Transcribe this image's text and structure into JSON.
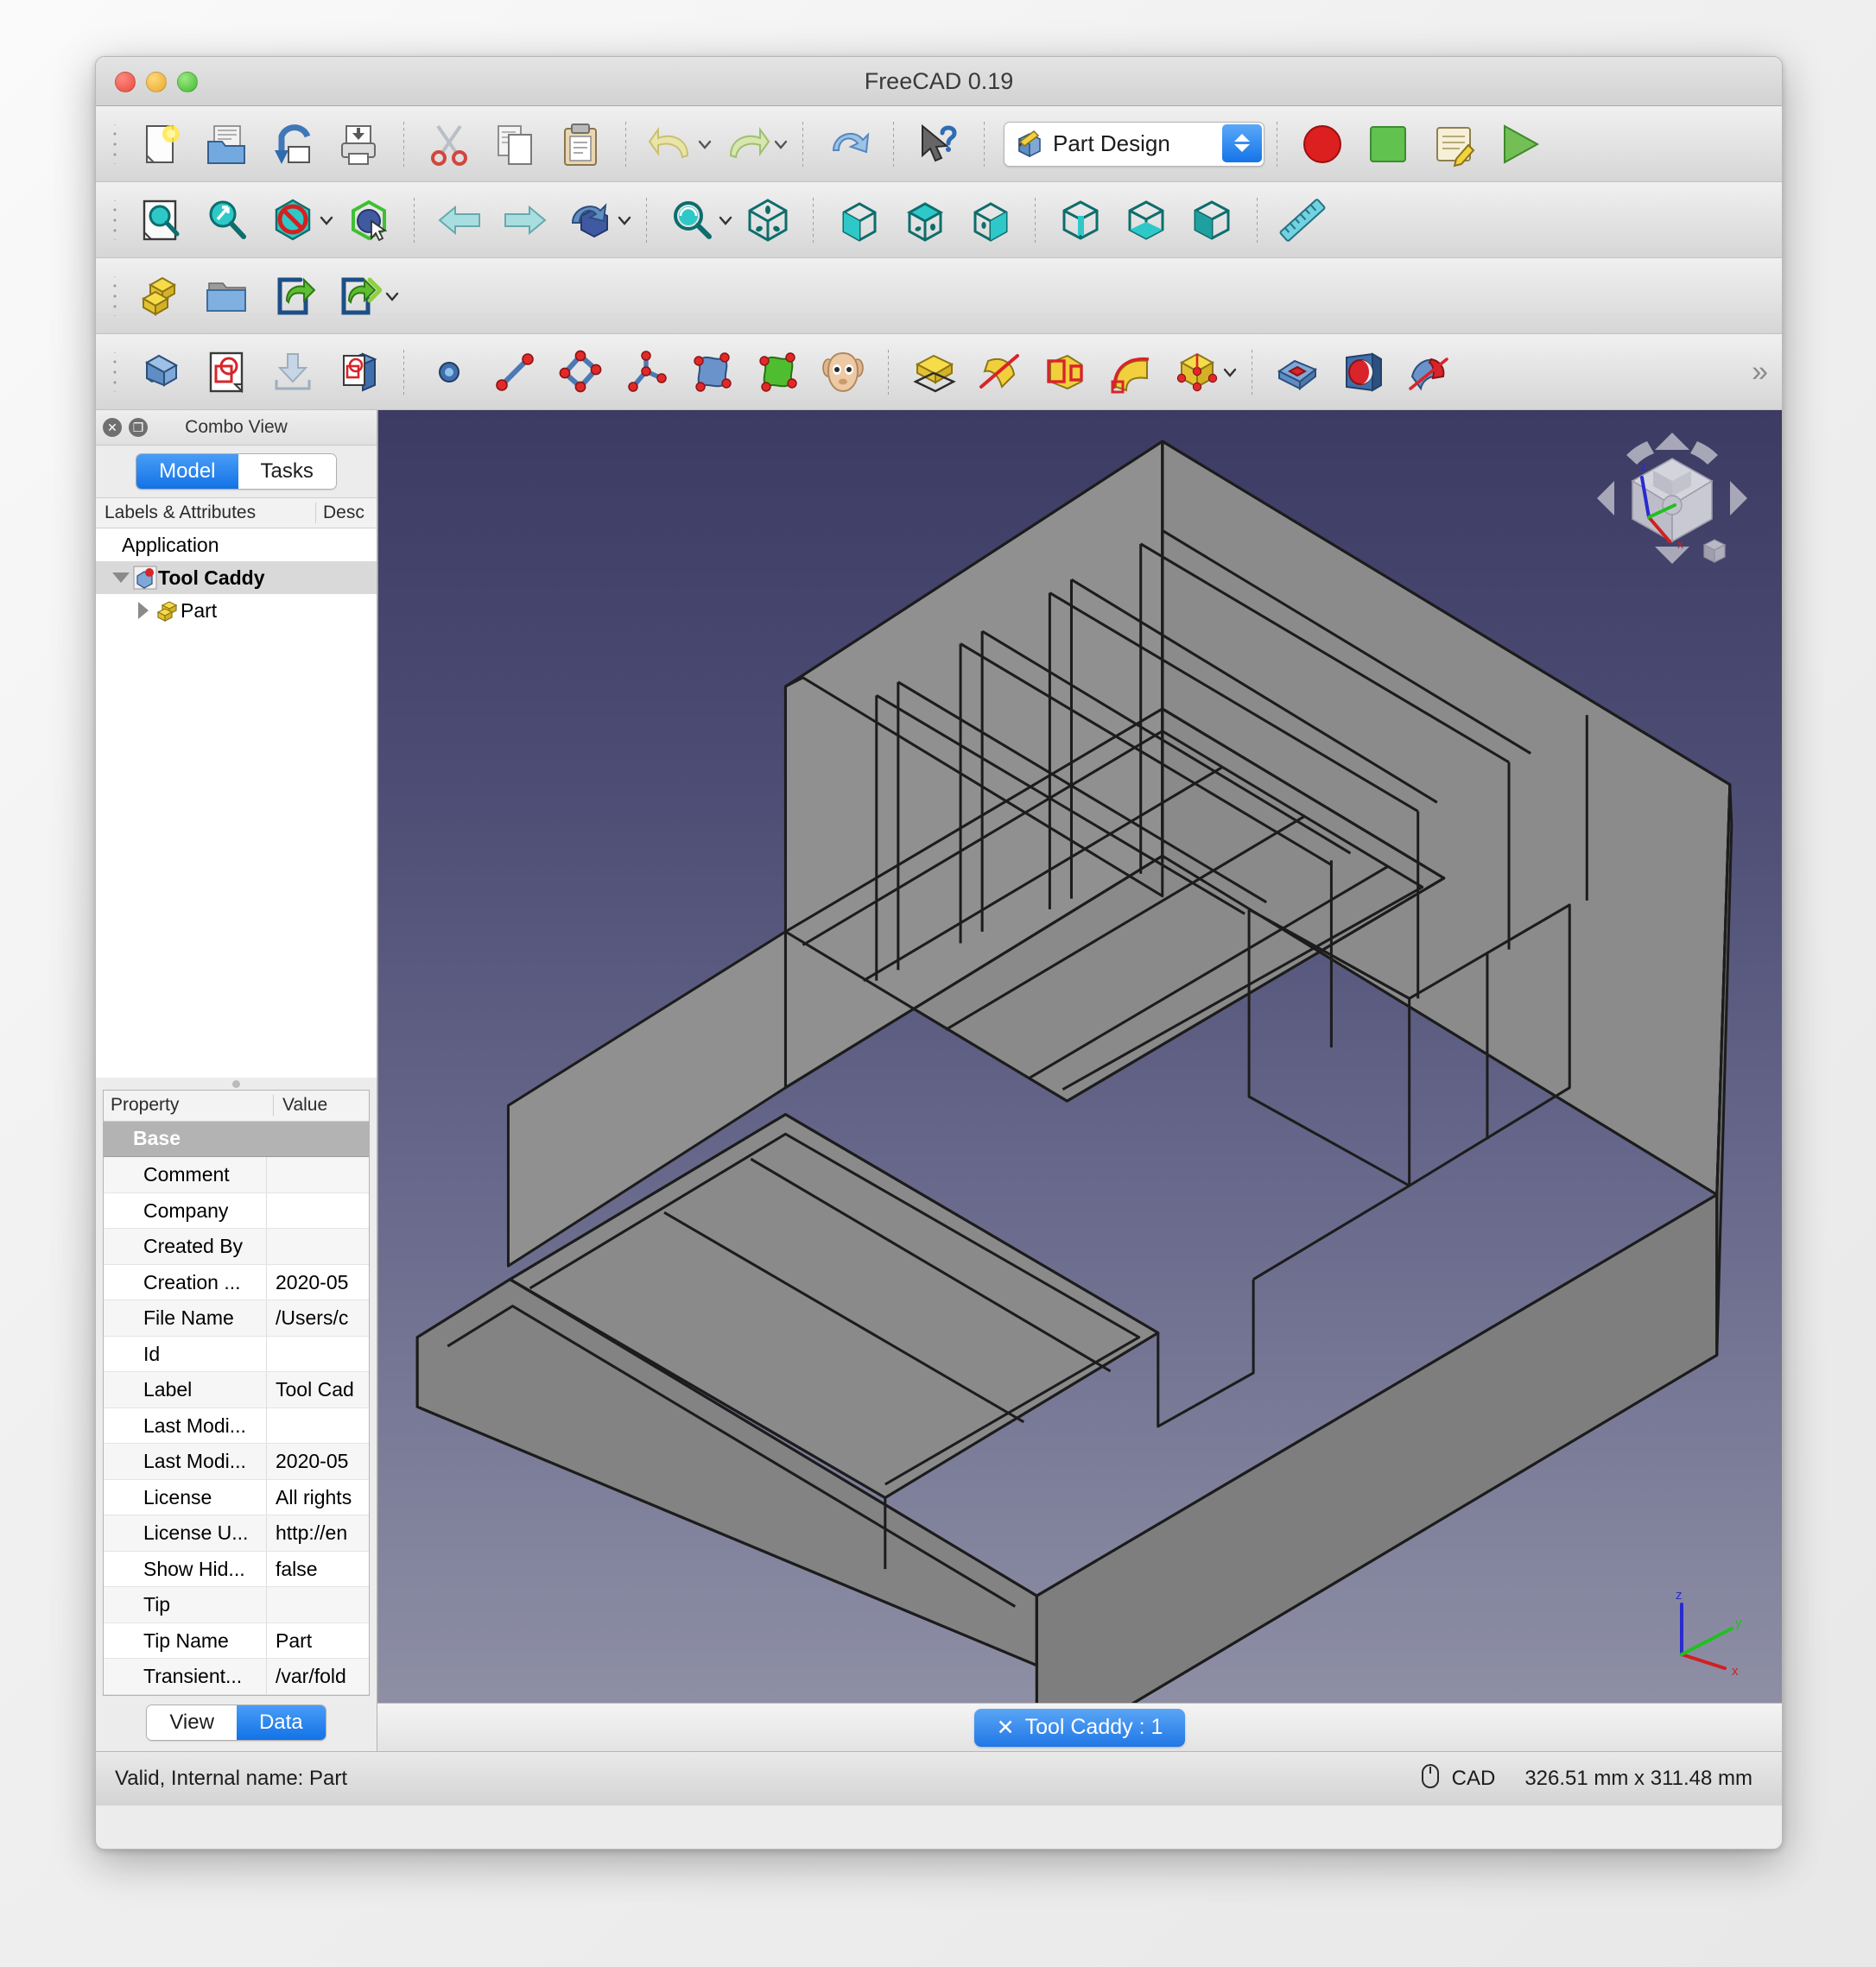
{
  "window": {
    "title": "FreeCAD 0.19",
    "traffic": [
      "close-button",
      "minimize-button",
      "zoom-button"
    ]
  },
  "toolbars": {
    "file": {
      "items": [
        {
          "name": "new-document",
          "icon": "new-file-icon"
        },
        {
          "name": "open-document",
          "icon": "open-folder-icon"
        },
        {
          "name": "save-document",
          "icon": "save-icon"
        },
        {
          "name": "print-document",
          "icon": "print-icon"
        }
      ]
    },
    "edit": {
      "items": [
        {
          "name": "cut",
          "icon": "scissors-icon"
        },
        {
          "name": "copy",
          "icon": "copy-icon"
        },
        {
          "name": "paste",
          "icon": "clipboard-icon"
        }
      ]
    },
    "history": {
      "items": [
        {
          "name": "undo",
          "icon": "undo-arrow-icon"
        },
        {
          "name": "redo",
          "icon": "redo-arrow-icon"
        },
        {
          "name": "refresh",
          "icon": "refresh-icon"
        }
      ]
    },
    "help": {
      "items": [
        {
          "name": "whats-this",
          "icon": "cursor-question-icon"
        }
      ]
    },
    "workbench": {
      "label": "Part Design",
      "icon": "part-design-icon"
    },
    "macro": {
      "items": [
        {
          "name": "macro-record",
          "icon": "record-circle-icon"
        },
        {
          "name": "macro-stop",
          "icon": "stop-square-icon"
        },
        {
          "name": "macros-dialog",
          "icon": "macro-editor-icon"
        },
        {
          "name": "execute-macro",
          "icon": "play-triangle-icon"
        }
      ]
    },
    "view_row": {
      "items": [
        {
          "name": "fit-all",
          "icon": "fit-all-icon"
        },
        {
          "name": "fit-selection",
          "icon": "fit-selection-icon"
        },
        {
          "name": "draw-style",
          "icon": "draw-style-icon"
        },
        {
          "name": "box-selection",
          "icon": "box-selection-icon"
        },
        {
          "name": "view-back",
          "icon": "left-arrow-icon"
        },
        {
          "name": "view-forward",
          "icon": "right-arrow-icon"
        },
        {
          "name": "axonometric",
          "icon": "axonometric-cube-icon"
        },
        {
          "name": "view-zoom",
          "icon": "zoom-magnifier-icon"
        },
        {
          "name": "view-isometric",
          "icon": "iso-cube-icon"
        },
        {
          "name": "view-front",
          "icon": "front-view-icon"
        },
        {
          "name": "view-top",
          "icon": "top-view-icon"
        },
        {
          "name": "view-right",
          "icon": "right-view-icon"
        },
        {
          "name": "view-rear",
          "icon": "rear-view-icon"
        },
        {
          "name": "view-bottom",
          "icon": "bottom-view-icon"
        },
        {
          "name": "view-left",
          "icon": "left-view-icon"
        },
        {
          "name": "measure",
          "icon": "ruler-icon"
        }
      ]
    },
    "structure_row": {
      "items": [
        {
          "name": "create-part",
          "icon": "yellow-part-icon"
        },
        {
          "name": "create-group",
          "icon": "blue-folder-icon"
        },
        {
          "name": "make-link",
          "icon": "link-arrow-icon"
        },
        {
          "name": "make-sub-link",
          "icon": "link-double-arrow-icon"
        }
      ]
    },
    "partdesign_row": {
      "items": [
        {
          "name": "create-body",
          "icon": "body-icon"
        },
        {
          "name": "create-sketch",
          "icon": "sketch-icon"
        },
        {
          "name": "attach-sketch",
          "icon": "attach-sketch-icon"
        },
        {
          "name": "validate-sketch",
          "icon": "validate-sketch-icon"
        },
        {
          "name": "create-point",
          "icon": "point-icon"
        },
        {
          "name": "create-line",
          "icon": "line-icon"
        },
        {
          "name": "create-plane",
          "icon": "plane-icon"
        },
        {
          "name": "create-local-cs",
          "icon": "coordinate-system-icon"
        },
        {
          "name": "shape-binder",
          "icon": "shape-binder-blue-icon"
        },
        {
          "name": "sub-shape-binder",
          "icon": "shape-binder-green-icon"
        },
        {
          "name": "clone-object",
          "icon": "sheep-clone-icon"
        },
        {
          "name": "pad",
          "icon": "pad-icon"
        },
        {
          "name": "revolution",
          "icon": "revolution-icon"
        },
        {
          "name": "additive-loft",
          "icon": "loft-icon"
        },
        {
          "name": "additive-pipe",
          "icon": "pipe-icon"
        },
        {
          "name": "additive-primitive",
          "icon": "additive-box-icon"
        },
        {
          "name": "pocket",
          "icon": "pocket-icon"
        },
        {
          "name": "hole",
          "icon": "hole-icon"
        },
        {
          "name": "groove",
          "icon": "groove-icon"
        }
      ],
      "overflow_label": "»"
    }
  },
  "combo_view": {
    "panel_title": "Combo View",
    "close_icon": "close-icon",
    "float_icon": "undock-icon",
    "tabs": [
      {
        "label": "Model",
        "selected": true
      },
      {
        "label": "Tasks",
        "selected": false
      }
    ],
    "tree_headers": {
      "labels": "Labels & Attributes",
      "description": "Desc"
    },
    "tree": [
      {
        "label": "Application",
        "depth": 0,
        "expander": "none",
        "icon": "none",
        "selected": false
      },
      {
        "label": "Tool Caddy",
        "depth": 1,
        "expander": "down",
        "icon": "document-icon",
        "selected": true
      },
      {
        "label": "Part",
        "depth": 2,
        "expander": "right",
        "icon": "part-icon",
        "selected": false
      }
    ],
    "property_headers": {
      "property": "Property",
      "value": "Value"
    },
    "properties": [
      {
        "name": "Base",
        "value": "",
        "group": true
      },
      {
        "name": "Comment",
        "value": ""
      },
      {
        "name": "Company",
        "value": ""
      },
      {
        "name": "Created By",
        "value": ""
      },
      {
        "name": "Creation ...",
        "value": "2020-05"
      },
      {
        "name": "File Name",
        "value": "/Users/c"
      },
      {
        "name": "Id",
        "value": ""
      },
      {
        "name": "Label",
        "value": "Tool Cad"
      },
      {
        "name": "Last Modi...",
        "value": ""
      },
      {
        "name": "Last Modi...",
        "value": "2020-05"
      },
      {
        "name": "License",
        "value": "All rights"
      },
      {
        "name": "License U...",
        "value": "http://en"
      },
      {
        "name": "Show Hid...",
        "value": "false"
      },
      {
        "name": "Tip",
        "value": ""
      },
      {
        "name": "Tip Name",
        "value": "Part"
      },
      {
        "name": "Transient...",
        "value": "/var/fold"
      }
    ],
    "bottom_tabs": [
      {
        "label": "View",
        "selected": false
      },
      {
        "label": "Data",
        "selected": true
      }
    ]
  },
  "viewport": {
    "document_tab": {
      "close_icon": "close-x-icon",
      "label": "Tool Caddy : 1"
    },
    "navigation_cube": "navigation-cube",
    "axis_labels": {
      "x": "x",
      "y": "y",
      "z": "z"
    },
    "background_top": "#3b3b63",
    "background_bottom": "#8e8fa5",
    "model_fill": "#838383",
    "model_edge": "#1a1a1a"
  },
  "status_bar": {
    "message": "Valid, Internal name: Part",
    "nav_icon": "mouse-icon",
    "nav_style": "CAD",
    "dimensions": "326.51 mm x 311.48 mm"
  }
}
